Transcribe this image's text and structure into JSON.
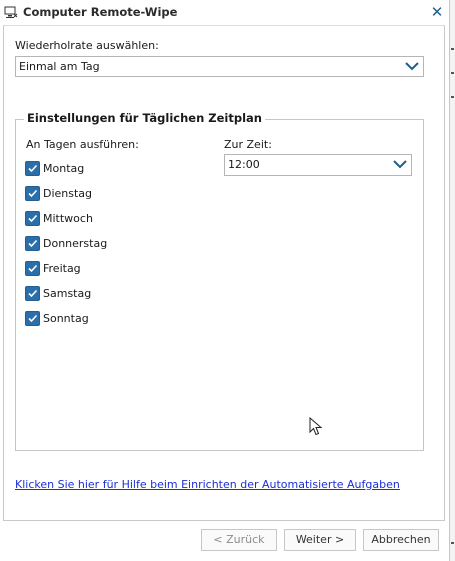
{
  "window": {
    "title": "Computer Remote-Wipe",
    "close_glyph": "✕"
  },
  "repeat": {
    "label": "Wiederholrate auswählen:",
    "value": "Einmal am Tag"
  },
  "schedule": {
    "group_title": "Einstellungen für Täglichen Zeitplan",
    "days_label": "An Tagen ausführen:",
    "time_label": "Zur Zeit:",
    "time_value": "12:00",
    "days": [
      {
        "label": "Montag",
        "checked": true
      },
      {
        "label": "Dienstag",
        "checked": true
      },
      {
        "label": "Mittwoch",
        "checked": true
      },
      {
        "label": "Donnerstag",
        "checked": true
      },
      {
        "label": "Freitag",
        "checked": true
      },
      {
        "label": "Samstag",
        "checked": true
      },
      {
        "label": "Sonntag",
        "checked": true
      }
    ]
  },
  "help_link": "Klicken Sie hier für Hilfe beim Einrichten der Automatisierte Aufgaben",
  "buttons": {
    "back": "< Zurück",
    "next": "Weiter >",
    "cancel": "Abbrechen"
  },
  "colors": {
    "accent": "#2a6eaa",
    "link": "#1a2fd6",
    "chevron": "#1f5f8b"
  },
  "icons": {
    "title": "computer-wipe-icon",
    "close": "close-icon",
    "dropdown": "chevron-down-icon",
    "checkbox": "checkmark-icon",
    "cursor": "mouse-pointer-icon"
  }
}
